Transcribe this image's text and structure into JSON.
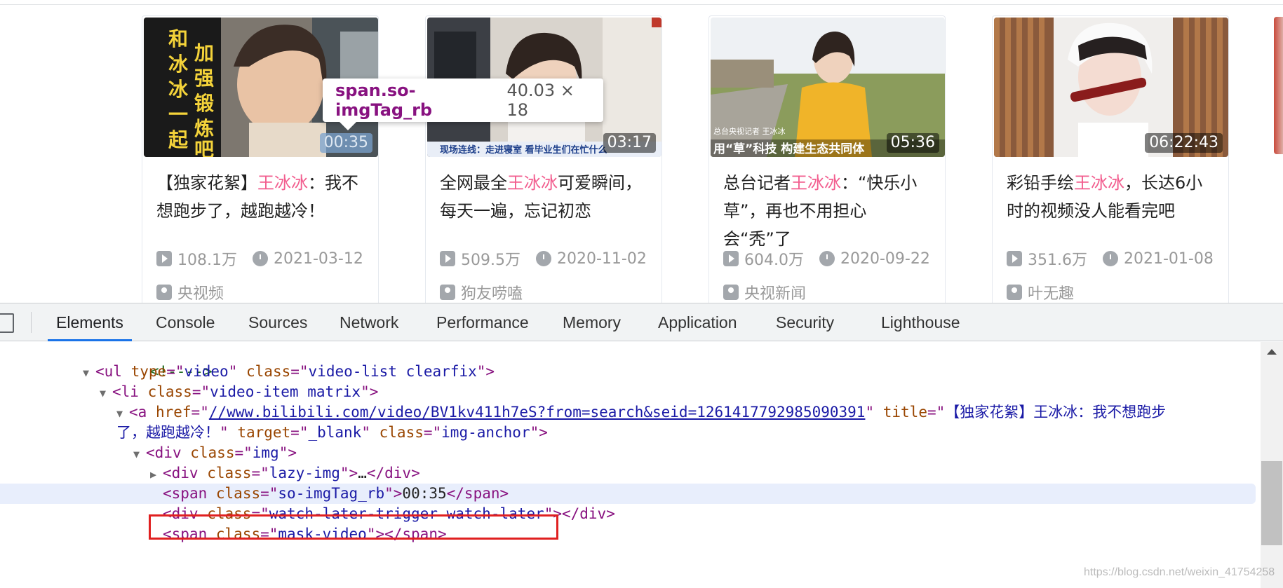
{
  "videos": [
    {
      "duration": "00:35",
      "title_before": "【独家花絮】",
      "title_keyword": "王冰冰",
      "title_after": "：我不想跑步了，越跑越冷！",
      "views": "108.1万",
      "date": "2021-03-12",
      "uploader": "央视频",
      "thumb_text": "加强锻炼吧 和冰冰一起"
    },
    {
      "duration": "03:17",
      "title_before": "全网最全",
      "title_keyword": "王冰冰",
      "title_after": "可爱瞬间，每天一遍，忘记初恋",
      "views": "509.5万",
      "date": "2020-11-02",
      "uploader": "狗友唠嗑",
      "thumb_text": "现场连线：走进寝室 看毕业生们在忙什么"
    },
    {
      "duration": "05:36",
      "title_before": "总台记者",
      "title_keyword": "王冰冰",
      "title_after": "：“快乐小草”，再也不用担心会“秃”了",
      "views": "604.0万",
      "date": "2020-09-22",
      "uploader": "央视新闻",
      "thumb_text": "用“草”科技 构建生态共同体"
    },
    {
      "duration": "06:22:43",
      "title_before": "彩铅手绘",
      "title_keyword": "王冰冰",
      "title_after": "，长达6小时的视频没人能看完吧",
      "views": "351.6万",
      "date": "2021-01-08",
      "uploader": "叶无趣",
      "thumb_text": ""
    }
  ],
  "tooltip": {
    "selector": "span.so-imgTag_rb",
    "size": "40.03 × 18"
  },
  "devtools": {
    "tabs": [
      "Elements",
      "Console",
      "Sources",
      "Network",
      "Performance",
      "Memory",
      "Application",
      "Security",
      "Lighthouse"
    ],
    "active_tab": "Elements"
  },
  "dom": {
    "comment": "<!---->",
    "ul_tag": "ul",
    "ul_type": "video",
    "ul_class": "video-list clearfix",
    "li_tag": "li",
    "li_class": "video-item matrix",
    "a_tag": "a",
    "a_href": "//www.bilibili.com/video/BV1kv411h7eS?from=search&seid=12614177929850903 91",
    "a_href_text": "//www.bilibili.com/video/BV1kv411h7eS?from=search&seid=1261417792985090391",
    "a_title_1": "【独家花絮】王冰冰：我不想跑步",
    "a_title_2": "了，越跑越冷！",
    "a_target": "_blank",
    "a_class": "img-anchor",
    "div_tag": "div",
    "div_class": "img",
    "lazy_class": "lazy-img",
    "ellipsis": "…",
    "span_tag": "span",
    "span_class": "so-imgTag_rb",
    "span_text": "00:35",
    "watch_class": "watch-later-trigger watch-later",
    "mask_class": "mask-video"
  },
  "watermark": "https://blog.csdn.net/weixin_41754258",
  "colors": {
    "keyword": "#f25d8e",
    "devtools_tag": "#881280",
    "devtools_attr": "#994500",
    "devtools_value": "#1a1aa6",
    "highlight_box": "#e02020",
    "active_tab": "#1a73e8"
  }
}
